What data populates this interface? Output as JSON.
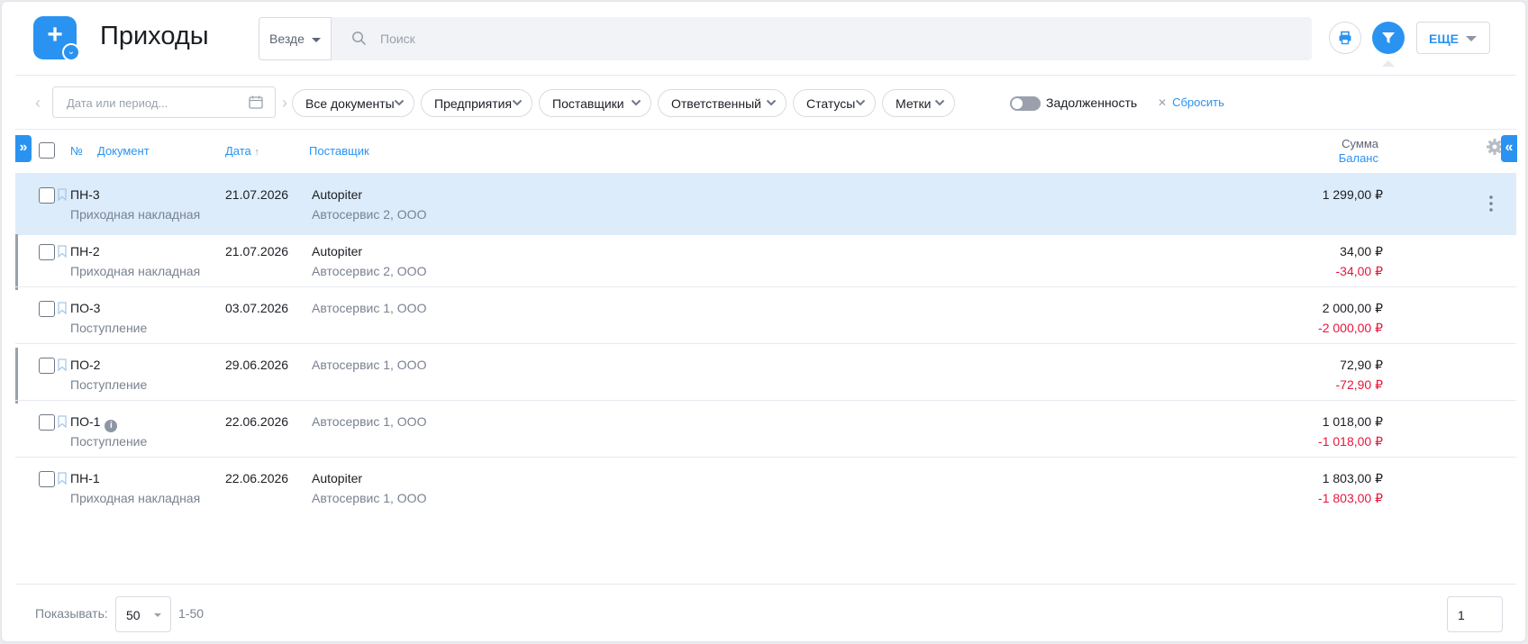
{
  "header": {
    "title": "Приходы",
    "scope_value": "Везде",
    "search_placeholder": "Поиск",
    "more_label": "ЕЩЕ"
  },
  "filters": {
    "date_placeholder": "Дата или период...",
    "chips": [
      "Все документы",
      "Предприятия",
      "Поставщики",
      "Ответственный",
      "Статусы",
      "Метки"
    ],
    "toggle_label": "Задолженность",
    "toggle_on": false,
    "reset_label": "Сбросить"
  },
  "table": {
    "columns": {
      "num": "№",
      "document": "Документ",
      "date": "Дата",
      "date_sort": "↑",
      "supplier": "Поставщик",
      "sum": "Сумма",
      "balance": "Баланс"
    },
    "rows": [
      {
        "num": "ПН-3",
        "type": "Приходная накладная",
        "date": "21.07.2026",
        "supplier": "Autopiter",
        "company": "Автосервис 2, ООО",
        "sum": "1 299,00 ₽",
        "balance": "",
        "selected": true,
        "flag": false,
        "info": false
      },
      {
        "num": "ПН-2",
        "type": "Приходная накладная",
        "date": "21.07.2026",
        "supplier": "Autopiter",
        "company": "Автосервис 2, ООО",
        "sum": "34,00 ₽",
        "balance": "-34,00 ₽",
        "selected": false,
        "flag": true,
        "info": false
      },
      {
        "num": "ПО-3",
        "type": "Поступление",
        "date": "03.07.2026",
        "supplier": "",
        "company": "Автосервис 1, ООО",
        "sum": "2 000,00 ₽",
        "balance": "-2 000,00 ₽",
        "selected": false,
        "flag": false,
        "info": false
      },
      {
        "num": "ПО-2",
        "type": "Поступление",
        "date": "29.06.2026",
        "supplier": "",
        "company": "Автосервис 1, ООО",
        "sum": "72,90 ₽",
        "balance": "-72,90 ₽",
        "selected": false,
        "flag": true,
        "info": false
      },
      {
        "num": "ПО-1",
        "type": "Поступление",
        "date": "22.06.2026",
        "supplier": "",
        "company": "Автосервис 1, ООО",
        "sum": "1 018,00 ₽",
        "balance": "-1 018,00 ₽",
        "selected": false,
        "flag": false,
        "info": true,
        "info_glyph": "i"
      },
      {
        "num": "ПН-1",
        "type": "Приходная накладная",
        "date": "22.06.2026",
        "supplier": "Autopiter",
        "company": "Автосервис 1, ООО",
        "sum": "1 803,00 ₽",
        "balance": "-1 803,00 ₽",
        "selected": false,
        "flag": false,
        "info": false
      }
    ]
  },
  "footer": {
    "show_label": "Показывать:",
    "per_page": "50",
    "range": "1-50",
    "page": "1"
  },
  "icons": {
    "add": "plus-icon",
    "search": "search-icon",
    "print": "printer-icon",
    "filter": "filter-icon",
    "calendar": "calendar-icon",
    "settings": "gear-icon",
    "bookmark": "bookmark-icon"
  },
  "colors": {
    "accent": "#2a93f1",
    "selected_row": "#dcecfb",
    "negative": "#e8163c"
  }
}
